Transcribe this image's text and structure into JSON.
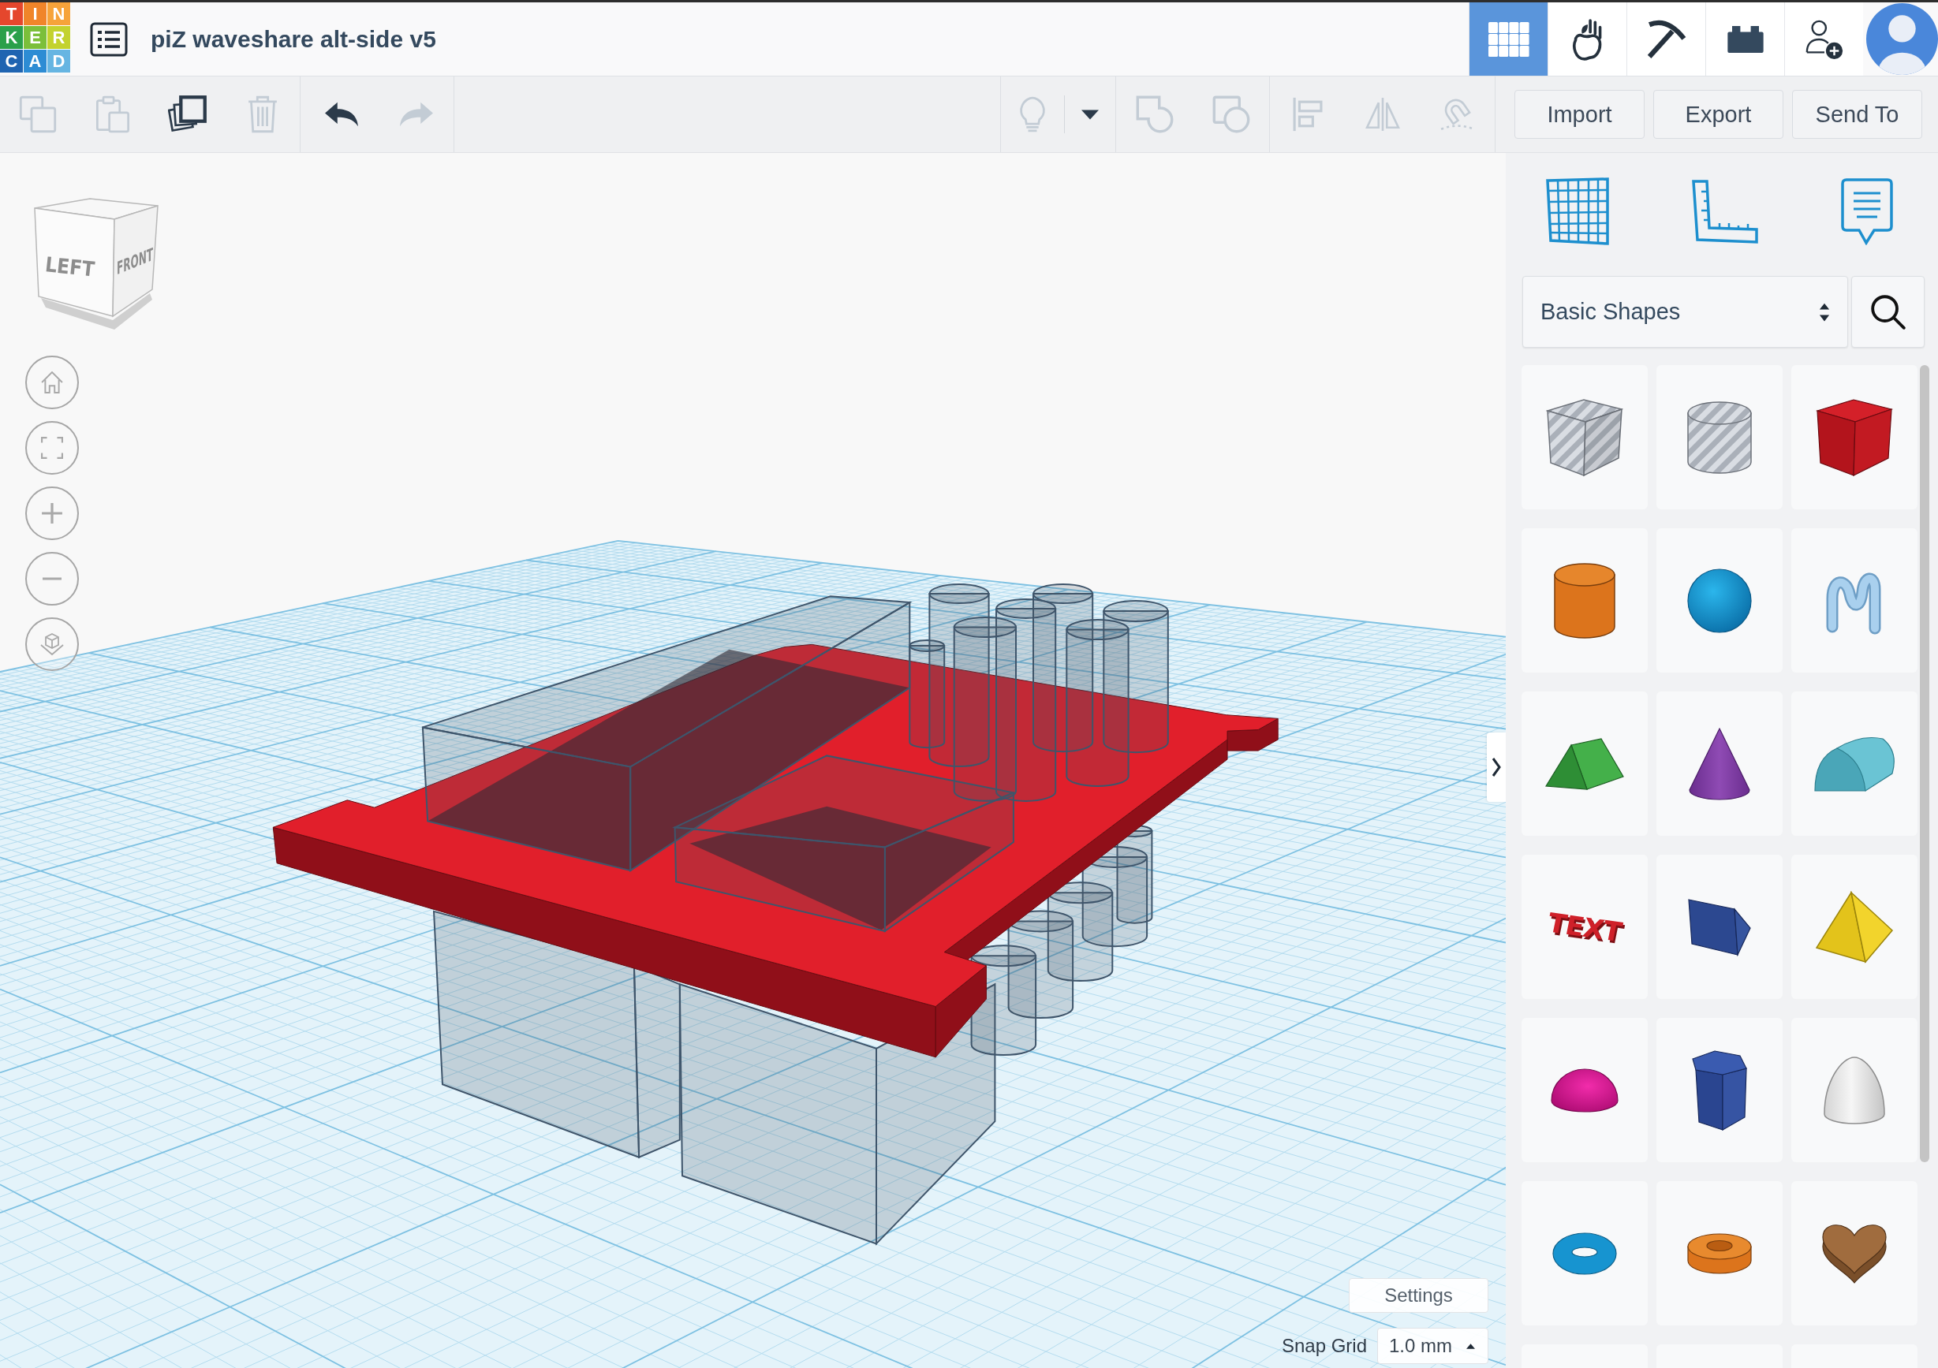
{
  "logo": {
    "tiles": [
      {
        "letter": "T",
        "color": "#e5472d"
      },
      {
        "letter": "I",
        "color": "#f0852a"
      },
      {
        "letter": "N",
        "color": "#f6a33a"
      },
      {
        "letter": "K",
        "color": "#2ba04a"
      },
      {
        "letter": "E",
        "color": "#7bbf3a"
      },
      {
        "letter": "R",
        "color": "#c3d22f"
      },
      {
        "letter": "C",
        "color": "#1f64b1"
      },
      {
        "letter": "A",
        "color": "#2d8cd4"
      },
      {
        "letter": "D",
        "color": "#66b5e2"
      }
    ]
  },
  "document": {
    "title": "piZ waveshare alt-side v5"
  },
  "top_tools": [
    {
      "kind": "grid",
      "selected": true
    },
    {
      "kind": "hand",
      "selected": false
    },
    {
      "kind": "pickaxe",
      "selected": false
    },
    {
      "kind": "brick",
      "selected": false
    },
    {
      "kind": "invite",
      "selected": false
    }
  ],
  "toolbar": {
    "edit_groups": [
      {
        "tools": [
          {
            "kind": "copy",
            "disabled": true
          },
          {
            "kind": "paste",
            "disabled": true
          },
          {
            "kind": "duplicate",
            "disabled": false
          },
          {
            "kind": "delete",
            "disabled": true
          }
        ]
      },
      {
        "tools": [
          {
            "kind": "undo",
            "disabled": false
          },
          {
            "kind": "redo",
            "disabled": true
          }
        ]
      }
    ],
    "shape_groups": [
      {
        "tools": [
          {
            "kind": "light",
            "disabled": true
          },
          {
            "kind": "dropdown",
            "disabled": false
          }
        ]
      },
      {
        "tools": [
          {
            "kind": "group",
            "disabled": true
          },
          {
            "kind": "ungroup",
            "disabled": true
          }
        ]
      },
      {
        "tools": [
          {
            "kind": "align",
            "disabled": true
          },
          {
            "kind": "mirror",
            "disabled": true
          },
          {
            "kind": "cruise",
            "disabled": true
          }
        ]
      }
    ],
    "actions": [
      "Import",
      "Export",
      "Send To"
    ]
  },
  "view_cube": {
    "faces": [
      "LEFT",
      "FRONT"
    ]
  },
  "shape_library": {
    "category": "Basic Shapes",
    "text_shape": "TEXT"
  },
  "settings_button": "Settings",
  "snap_grid": {
    "label": "Snap Grid",
    "value": "1.0 mm"
  }
}
